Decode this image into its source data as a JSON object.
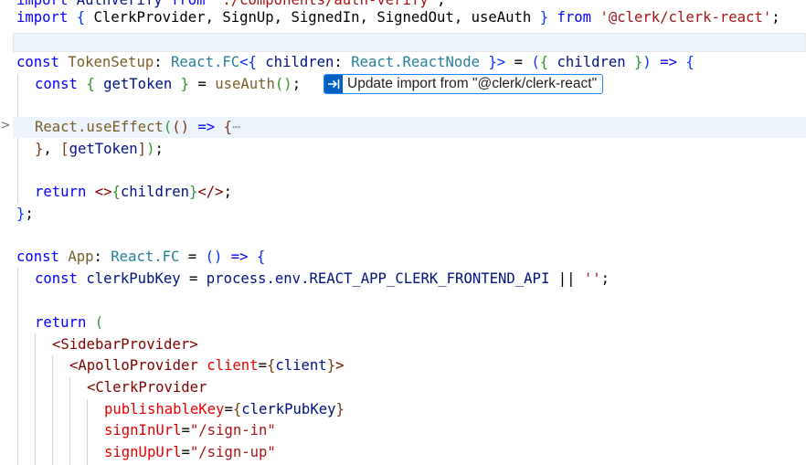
{
  "editor": {
    "lines": [
      {
        "text": "import AuthVerify from './components/auth-verify';"
      },
      {
        "text": "import { ClerkProvider, SignUp, SignedIn, SignedOut, useAuth } from '@clerk/clerk-react';"
      },
      {
        "text": ""
      },
      {
        "text": "const TokenSetup: React.FC<{ children: React.ReactNode }> = ({ children }) => {"
      },
      {
        "text": "const { getToken } = useAuth();"
      },
      {
        "text": ""
      },
      {
        "text": "React.useEffect(() => {⋯"
      },
      {
        "text": "}, [getToken]);"
      },
      {
        "text": ""
      },
      {
        "text": "return <>{children}</>;"
      },
      {
        "text": "};"
      },
      {
        "text": ""
      },
      {
        "text": "const App: React.FC = () => {"
      },
      {
        "text": "const clerkPubKey = process.env.REACT_APP_CLERK_FRONTEND_API || '';"
      },
      {
        "text": ""
      },
      {
        "text": "return ("
      },
      {
        "text": "<SidebarProvider>"
      },
      {
        "text": "<ApolloProvider client={client}>"
      },
      {
        "text": "<ClerkProvider"
      },
      {
        "text": "publishableKey={clerkPubKey}"
      },
      {
        "text": "signInUrl=\"/sign-in\""
      },
      {
        "text": "signUpUrl=\"/sign-up\""
      }
    ],
    "tokens": {
      "import": "import",
      "authverify": "AuthVerify",
      "from": "from",
      "authverify_path": "'./components/auth-verify'",
      "semicolon": ";",
      "clerk_imports": "ClerkProvider, SignUp, SignedIn, SignedOut, useAuth",
      "clerk_path": "'@clerk/clerk-react'",
      "const": "const",
      "token_setup": "TokenSetup",
      "react_fc": "React.FC",
      "children": "children",
      "react_node": "React.ReactNode",
      "get_token": "getToken",
      "use_auth": "useAuth",
      "react_use_effect": "React.useEffect",
      "return": "return",
      "app": "App",
      "clerk_pub_key": "clerkPubKey",
      "process_env": "process.env.REACT_APP_CLERK_FRONTEND_API",
      "empty_string": "''",
      "sidebar_provider": "SidebarProvider",
      "apollo_provider": "ApolloProvider",
      "client_attr": "client",
      "client_value": "client",
      "clerk_provider": "ClerkProvider",
      "publishable_key": "publishableKey",
      "sign_in_url": "signInUrl",
      "sign_in_value": "\"/sign-in\"",
      "sign_up_url": "signUpUrl",
      "sign_up_value": "\"/sign-up\""
    }
  },
  "quick_fix": {
    "label": "Update import from \"@clerk/clerk-react\"",
    "icon": "insert-arrow-icon"
  },
  "fold": {
    "collapsed_marker": ">",
    "ellipsis": "⋯"
  },
  "colors": {
    "keyword": "#0000ff",
    "string": "#a31515",
    "tag": "#800000",
    "attribute": "#e50000",
    "current_line": "#eef4fc",
    "quick_fix_border": "#1a85ff"
  }
}
